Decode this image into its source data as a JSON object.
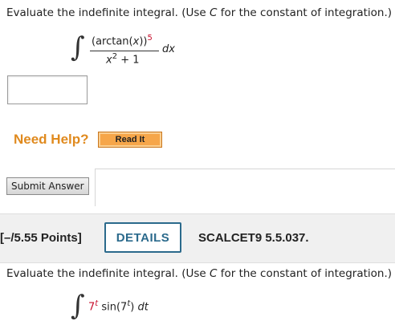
{
  "question1": {
    "prompt_prefix": "Evaluate the indefinite integral. (Use ",
    "prompt_var": "C",
    "prompt_suffix": " for the constant of integration.)",
    "integral": {
      "sign": "∫",
      "numerator_pre": "(arctan(",
      "numerator_var": "x",
      "numerator_post": "))",
      "numerator_exp": "5",
      "denominator_var": "x",
      "denominator_exp": "2",
      "denominator_rest": " + 1",
      "differential": "dx"
    },
    "answer_value": ""
  },
  "help": {
    "label": "Need Help?",
    "read_it_label": "Read It"
  },
  "submit": {
    "label": "Submit Answer"
  },
  "question2": {
    "points_label": "[–/5.55 Points]",
    "details_label": "DETAILS",
    "reference": "SCALCET9 5.5.037.",
    "prompt_prefix": "Evaluate the indefinite integral. (Use ",
    "prompt_var": "C",
    "prompt_suffix": " for the constant of integration.)",
    "integral": {
      "sign": "∫",
      "base": "7",
      "base_exp": "t",
      "func": " sin(7",
      "func_exp": "t",
      "func_close": ")",
      "differential": "dt"
    }
  },
  "colors": {
    "need_help": "#e08a1e",
    "read_it_bg": "#f6a64a",
    "details_accent": "#2b6a8c",
    "exponent_red": "#c8102e",
    "bar_bg": "#f0f0f0"
  }
}
